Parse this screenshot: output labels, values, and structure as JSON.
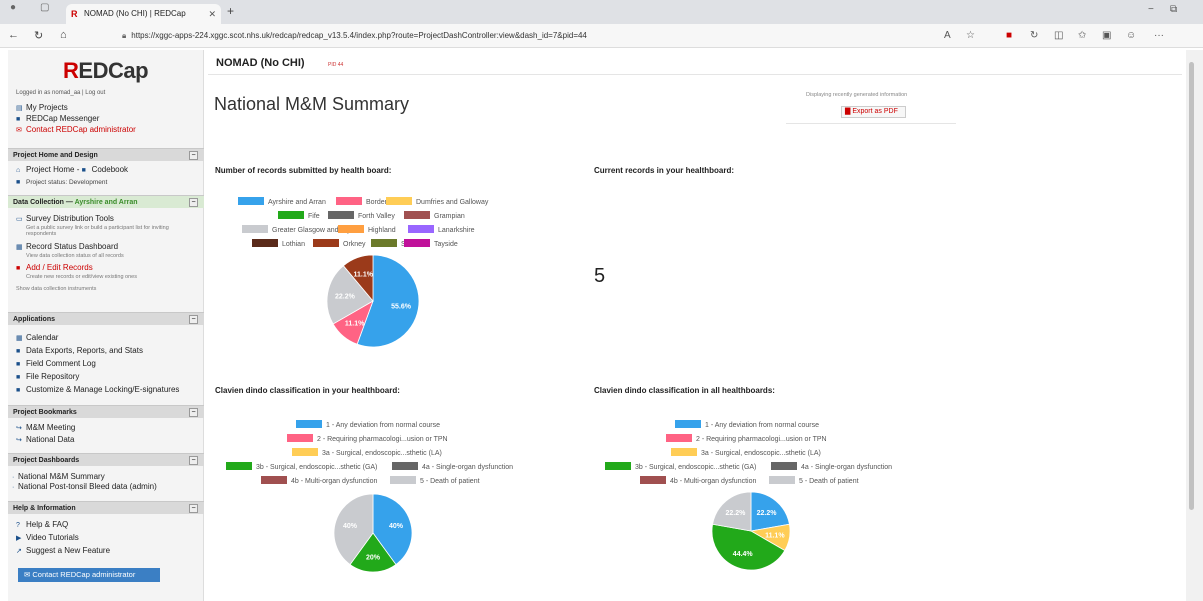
{
  "browser": {
    "tab_title": "NOMAD (No CHI) | REDCap",
    "url": "https://xggc-apps-224.xggc.scot.nhs.uk/redcap/redcap_v13.5.4/index.php?route=ProjectDashController:view&dash_id=7&pid=44"
  },
  "sidebar": {
    "brand": "REDCap",
    "logged_in": "Logged in as nomad_aa | Log out",
    "links": {
      "my_projects": "My Projects",
      "messenger": "REDCap Messenger",
      "contact_admin": "Contact REDCap administrator"
    },
    "sections": {
      "home": {
        "title": "Project Home and Design",
        "project_home": "Project Home",
        "codebook": "Codebook",
        "status": "Project status: Development"
      },
      "data_collection": {
        "title": "Data Collection",
        "subtitle": "Ayrshire and Arran",
        "survey_tools": "Survey Distribution Tools",
        "survey_tools_note": "Get a public survey link or build a participant list for inviting respondents",
        "record_status": "Record Status Dashboard",
        "record_status_note": "View data collection status of all records",
        "add_edit": "Add / Edit Records",
        "add_edit_note": "Create new records or edit/view existing ones",
        "show_instruments": "Show data collection instruments"
      },
      "applications": {
        "title": "Applications",
        "items": [
          "Calendar",
          "Data Exports, Reports, and Stats",
          "Field Comment Log",
          "File Repository",
          "Customize & Manage Locking/E-signatures"
        ]
      },
      "bookmarks": {
        "title": "Project Bookmarks",
        "items": [
          "M&M Meeting",
          "National Data"
        ]
      },
      "dashboards": {
        "title": "Project Dashboards",
        "items": [
          "National M&M Summary",
          "National Post-tonsil Bleed data (admin)"
        ]
      },
      "help": {
        "title": "Help & Information",
        "items": [
          "Help & FAQ",
          "Video Tutorials",
          "Suggest a New Feature"
        ]
      }
    },
    "contact_button": "Contact REDCap administrator"
  },
  "main": {
    "project_title": "NOMAD (No CHI)",
    "pid": "PID 44",
    "page_title": "National M&M Summary",
    "displaying_note": "Displaying recently generated information",
    "export_button": "Export as PDF",
    "current_records_title": "Current records in your healthboard:",
    "current_records_value": "5"
  },
  "colors": {
    "blue": "#36a2eb",
    "pink": "#ff6384",
    "yellow": "#ffcd56",
    "green": "#22a91a",
    "darkgrey": "#666666",
    "brownred": "#a05050",
    "lightgrey": "#c9cbcf",
    "orange": "#ff9f40",
    "purple": "#9966ff",
    "darkbrown": "#5a2a1a",
    "rust": "#9b3a1a",
    "olive": "#6b7a2a",
    "magenta": "#c0119a"
  },
  "chart_data": [
    {
      "type": "pie",
      "title": "Number of records submitted by health board:",
      "categories": [
        "Ayrshire and Arran",
        "Borders",
        "Dumfries and Galloway",
        "Fife",
        "Forth Valley",
        "Grampian",
        "Greater Glasgow and Clyde",
        "Highland",
        "Lanarkshire",
        "Lothian",
        "Orkney",
        "Shetland",
        "Tayside"
      ],
      "values": [
        55.6,
        11.1,
        0,
        0,
        0,
        0,
        22.2,
        0,
        0,
        0,
        11.1,
        0,
        0
      ],
      "labels": [
        "55.6%",
        "11.1%",
        "",
        "",
        "",
        "",
        "22.2%",
        "",
        "",
        "",
        "11.1%",
        "",
        ""
      ],
      "colors": [
        "#36a2eb",
        "#ff6384",
        "#ffcd56",
        "#22a91a",
        "#666666",
        "#a05050",
        "#c9cbcf",
        "#ff9f40",
        "#9966ff",
        "#5a2a1a",
        "#9b3a1a",
        "#6b7a2a",
        "#c0119a"
      ],
      "legend": "top"
    },
    {
      "type": "pie",
      "title": "Clavien dindo classification in your healthboard:",
      "categories": [
        "1 - Any deviation from normal course",
        "2 - Requiring pharmacologi...usion or TPN",
        "3a - Surgical, endoscopic...sthetic (LA)",
        "3b - Surgical, endoscopic...sthetic (GA)",
        "4a - Single-organ dysfunction",
        "4b - Multi-organ dysfunction",
        "5 - Death of patient"
      ],
      "values": [
        40,
        0,
        0,
        20,
        0,
        0,
        40
      ],
      "labels": [
        "40%",
        "",
        "",
        "20%",
        "",
        "",
        "40%"
      ],
      "colors": [
        "#36a2eb",
        "#ff6384",
        "#ffcd56",
        "#22a91a",
        "#666666",
        "#a05050",
        "#c9cbcf"
      ],
      "legend": "top"
    },
    {
      "type": "pie",
      "title": "Clavien dindo classification in all healthboards:",
      "categories": [
        "1 - Any deviation from normal course",
        "2 - Requiring pharmacologi...usion or TPN",
        "3a - Surgical, endoscopic...sthetic (LA)",
        "3b - Surgical, endoscopic...sthetic (GA)",
        "4a - Single-organ dysfunction",
        "4b - Multi-organ dysfunction",
        "5 - Death of patient"
      ],
      "values": [
        22.2,
        0,
        11.1,
        44.4,
        0,
        0,
        22.2
      ],
      "labels": [
        "22.2%",
        "",
        "11.1%",
        "44.4%",
        "",
        "",
        "22.2%"
      ],
      "colors": [
        "#36a2eb",
        "#ff6384",
        "#ffcd56",
        "#22a91a",
        "#666666",
        "#a05050",
        "#c9cbcf"
      ],
      "legend": "top"
    }
  ]
}
